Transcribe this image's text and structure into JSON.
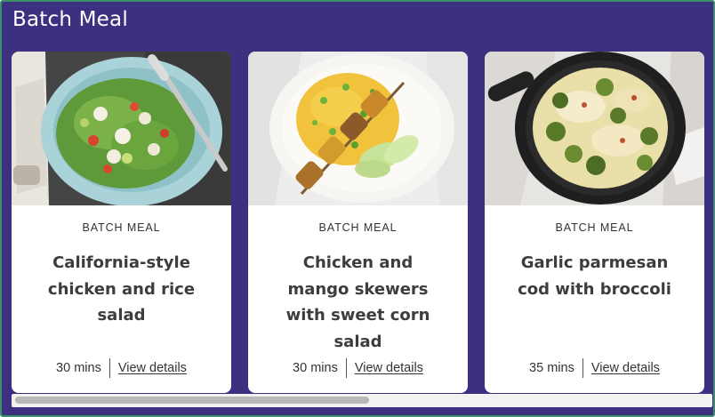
{
  "section": {
    "title": "Batch Meal"
  },
  "cards": [
    {
      "badge": "BATCH MEAL",
      "title": "California-style chicken and rice salad",
      "duration": "30 mins",
      "link": "View details",
      "image": "chicken-rice-salad-bowl-photo"
    },
    {
      "badge": "BATCH MEAL",
      "title": "Chicken and mango skewers with sweet corn salad",
      "duration": "30 mins",
      "link": "View details",
      "image": "chicken-mango-skewers-plate-photo"
    },
    {
      "badge": "BATCH MEAL",
      "title": "Garlic parmesan cod with broccoli",
      "duration": "35 mins",
      "link": "View details",
      "image": "garlic-parmesan-cod-skillet-photo"
    }
  ],
  "scrollbar": {
    "position": 0.0,
    "visible_fraction": 0.5
  },
  "colors": {
    "section_background": "#3b3180",
    "card_background": "#ffffff",
    "text": "#333333"
  }
}
